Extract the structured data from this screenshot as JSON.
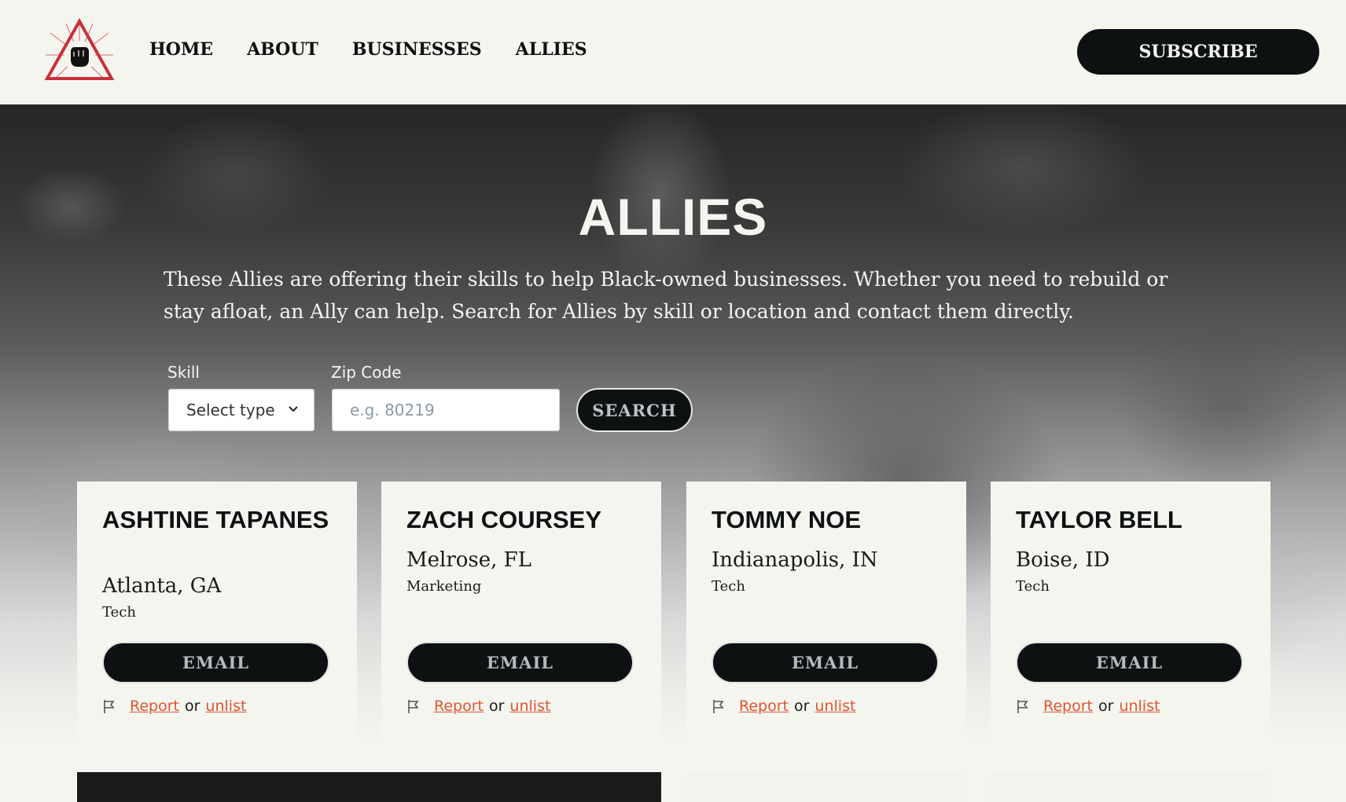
{
  "header": {
    "nav": [
      "HOME",
      "ABOUT",
      "BUSINESSES",
      "ALLIES"
    ],
    "subscribe_label": "SUBSCRIBE"
  },
  "hero": {
    "title": "ALLIES",
    "description": "These Allies are offering their skills to help Black-owned businesses. Whether you need to rebuild or stay afloat, an Ally can help. Search for Allies by skill or location and contact them directly."
  },
  "search": {
    "skill_label": "Skill",
    "skill_value": "Select type",
    "zip_label": "Zip Code",
    "zip_placeholder": "e.g. 80219",
    "button_label": "SEARCH"
  },
  "cards": [
    {
      "name": "ASHTINE TAPANES",
      "location": "Atlanta, GA",
      "skill": "Tech"
    },
    {
      "name": "ZACH COURSEY",
      "location": "Melrose, FL",
      "skill": "Marketing"
    },
    {
      "name": "TOMMY NOE",
      "location": "Indianapolis, IN",
      "skill": "Tech"
    },
    {
      "name": "TAYLOR BELL",
      "location": "Boise, ID",
      "skill": "Tech"
    }
  ],
  "card_actions": {
    "email_label": "EMAIL",
    "report_label": "Report",
    "or_label": "or",
    "unlist_label": "unlist"
  },
  "colors": {
    "accent": "#e0552f",
    "dark": "#0d1112",
    "cream": "#f5f5f0",
    "logo_red": "#c8313a"
  }
}
